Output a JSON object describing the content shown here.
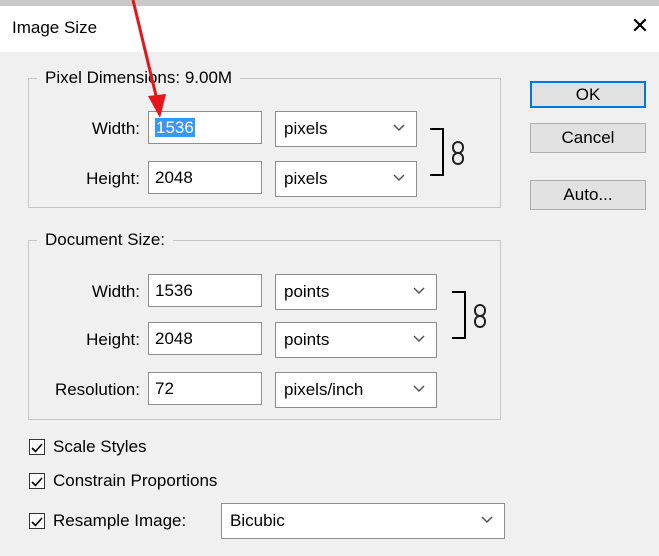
{
  "window": {
    "title": "Image Size",
    "close_glyph": "✕"
  },
  "pixel_dimensions": {
    "legend": "Pixel Dimensions:",
    "size": "9.00M",
    "width_label": "Width:",
    "width_value": "1536",
    "width_unit": "pixels",
    "height_label": "Height:",
    "height_value": "2048",
    "height_unit": "pixels"
  },
  "document_size": {
    "legend": "Document Size:",
    "width_label": "Width:",
    "width_value": "1536",
    "width_unit": "points",
    "height_label": "Height:",
    "height_value": "2048",
    "height_unit": "points",
    "resolution_label": "Resolution:",
    "resolution_value": "72",
    "resolution_unit": "pixels/inch"
  },
  "buttons": {
    "ok": "OK",
    "cancel": "Cancel",
    "auto": "Auto..."
  },
  "options": {
    "scale_styles": "Scale Styles",
    "constrain_proportions": "Constrain Proportions",
    "resample_image": "Resample Image:",
    "resample_method": "Bicubic"
  },
  "colors": {
    "annotation_arrow": "#e8141c",
    "selection": "#3399ff",
    "default_button_border": "#0078d7"
  },
  "icons": {
    "link": "chain-link-icon",
    "dropdown": "chevron-down-icon",
    "check": "checkmark-icon"
  }
}
